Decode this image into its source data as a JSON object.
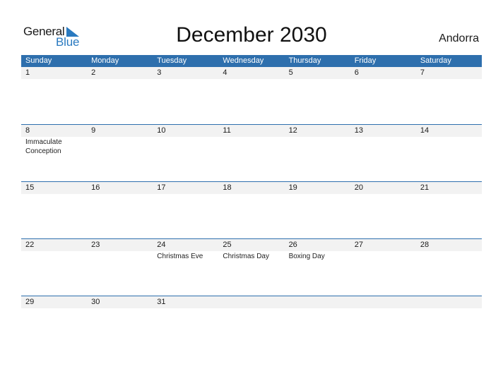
{
  "logo": {
    "part1": "General",
    "part2": "Blue",
    "icon": "triangle-flag-icon"
  },
  "title": "December 2030",
  "country": "Andorra",
  "colors": {
    "header_bg": "#2e6fad",
    "logo_blue": "#2a7ac0",
    "day_bar_bg": "#f2f2f2"
  },
  "weekdays": [
    "Sunday",
    "Monday",
    "Tuesday",
    "Wednesday",
    "Thursday",
    "Friday",
    "Saturday"
  ],
  "weeks": [
    {
      "days": [
        "1",
        "2",
        "3",
        "4",
        "5",
        "6",
        "7"
      ],
      "events": [
        "",
        "",
        "",
        "",
        "",
        "",
        ""
      ]
    },
    {
      "days": [
        "8",
        "9",
        "10",
        "11",
        "12",
        "13",
        "14"
      ],
      "events": [
        "Immaculate Conception",
        "",
        "",
        "",
        "",
        "",
        ""
      ]
    },
    {
      "days": [
        "15",
        "16",
        "17",
        "18",
        "19",
        "20",
        "21"
      ],
      "events": [
        "",
        "",
        "",
        "",
        "",
        "",
        ""
      ]
    },
    {
      "days": [
        "22",
        "23",
        "24",
        "25",
        "26",
        "27",
        "28"
      ],
      "events": [
        "",
        "",
        "Christmas Eve",
        "Christmas Day",
        "Boxing Day",
        "",
        ""
      ]
    },
    {
      "days": [
        "29",
        "30",
        "31",
        "",
        "",
        "",
        ""
      ],
      "events": [
        "",
        "",
        "",
        "",
        "",
        "",
        ""
      ]
    }
  ]
}
